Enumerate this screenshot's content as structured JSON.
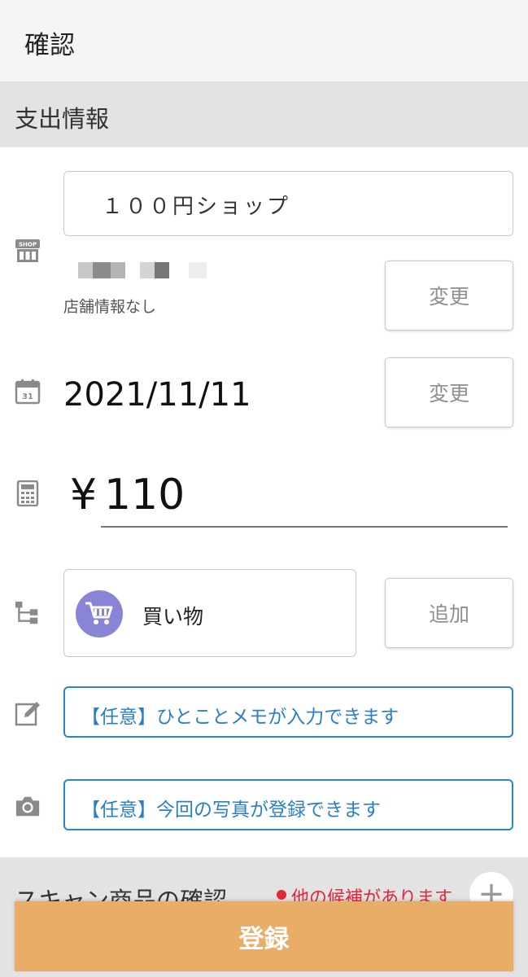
{
  "header": {
    "title": "確認"
  },
  "expense_section": {
    "title": "支出情報"
  },
  "shop": {
    "name": "１００円ショップ",
    "info": "店舗情報なし",
    "change_label": "変更"
  },
  "date": {
    "value": "2021/11/11",
    "change_label": "変更"
  },
  "amount": {
    "currency": "¥",
    "value": "110"
  },
  "category": {
    "label": "買い物",
    "add_label": "追加"
  },
  "memo": {
    "placeholder": "【任意】ひとことメモが入力できます"
  },
  "photo": {
    "placeholder": "【任意】今回の写真が登録できます"
  },
  "scan_section": {
    "title": "スキャン商品の確認",
    "notice": "他の候補があります"
  },
  "footer": {
    "register_label": "登録"
  },
  "colors": {
    "accent": "#e8ad67",
    "link_blue": "#2b84d0",
    "alert_red": "#e0283a",
    "category_purple": "#8a84d6"
  }
}
